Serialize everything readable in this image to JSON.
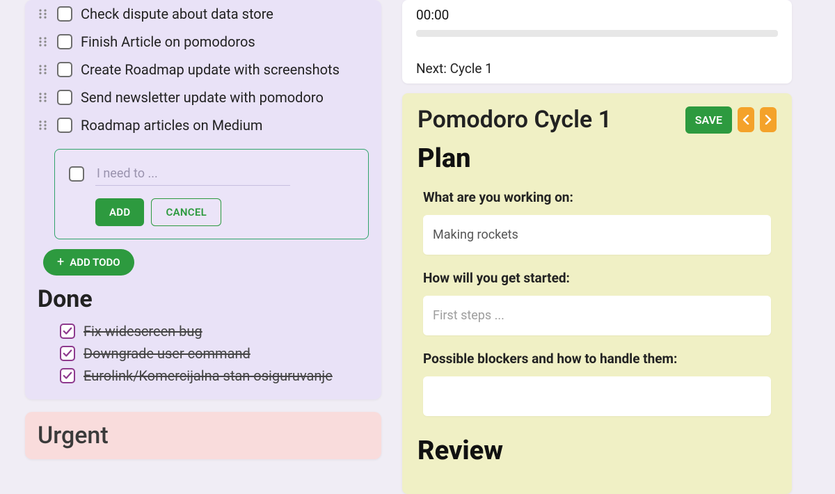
{
  "todos": [
    {
      "label": "Check dispute about data store"
    },
    {
      "label": "Finish Article on pomodoros"
    },
    {
      "label": "Create Roadmap update with screenshots"
    },
    {
      "label": "Send newsletter update with pomodoro"
    },
    {
      "label": "Roadmap articles on Medium"
    }
  ],
  "add_form": {
    "placeholder": "I need to ...",
    "add_label": "ADD",
    "cancel_label": "CANCEL"
  },
  "add_todo_button": "ADD TODO",
  "done_heading": "Done",
  "done_items": [
    {
      "label": "Fix widescreen bug"
    },
    {
      "label": "Downgrade user command"
    },
    {
      "label": "Eurolink/Komercijalna stan osiguruvanje"
    }
  ],
  "urgent_heading": "Urgent",
  "timer": {
    "time": "00:00",
    "next": "Next: Cycle 1"
  },
  "cycle": {
    "title": "Pomodoro Cycle 1",
    "save_label": "SAVE",
    "plan_heading": "Plan",
    "q1_label": "What are you working on:",
    "q1_value": "Making rockets",
    "q2_label": "How will you get started:",
    "q2_placeholder": "First steps ...",
    "q3_label": "Possible blockers and how to handle them:",
    "review_heading": "Review"
  }
}
